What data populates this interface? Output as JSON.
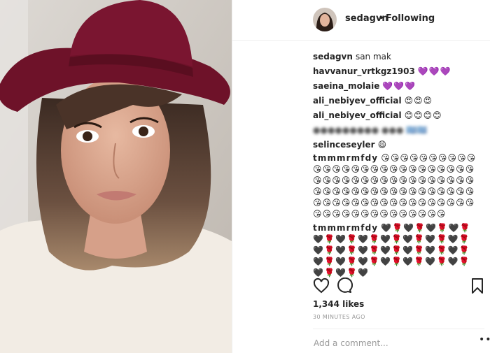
{
  "header": {
    "username": "sedagvn",
    "separator": "•",
    "follow_status": "Following"
  },
  "comments": [
    {
      "user": "sedagvn",
      "text": "san mak"
    },
    {
      "user": "havvanur_vrtkgz1903",
      "text": "💜💜💜"
    },
    {
      "user": "saeina_molaie",
      "text": "💜💜💜"
    },
    {
      "user": "ali_nebiyev_official",
      "text": "😍😍😍"
    },
    {
      "user": "ali_nebiyev_official",
      "text": "😊😊😊😊"
    },
    {
      "user": "",
      "text": "●●●●●●●●● ●●● 🇬🇷🇬🇷"
    },
    {
      "user": "selinceseyler",
      "text": "😄"
    },
    {
      "user": "tmmmrmfdy",
      "text": "😘😘😘😘😘😘😘😘😘😘😘😘😘😘😘😘😘😘😘😘😘😘😘😘😘😘😘😘😘😘😘😘😘😘😘😘😘😘😘😘😘😘😘😘😘😘😘😘😘😘😘😘😘😘😘😘😘😘😘😘😘😘😘😘😘😘😘😘😘😘😘😘😘😘😘😘😘😘😘😘😘😘😘😘😘😘😘😘😘😘😘😘"
    },
    {
      "user": "tmmmrmfdy",
      "text": "🖤🌹🖤🌹🖤🌹🖤🌹🖤🌹🖤🌹🖤🌹🖤🌹🖤🌹🖤🌹🖤🌹🖤🌹🖤🌹🖤🌹🖤🌹🖤🌹🖤🌹🖤🌹🖤🌹🖤🌹🖤🌹🖤🌹🖤🌹🖤🌹🖤🌹🖤🌹🖤🌹🖤"
    }
  ],
  "likes": "1,344 likes",
  "timestamp": "30 MINUTES AGO",
  "comment_placeholder": "Add a comment...",
  "more_label": "•••",
  "icons": {
    "like": "heart-icon",
    "comment": "comment-bubble-icon",
    "save": "bookmark-icon",
    "more": "more-options-icon"
  },
  "colors": {
    "hat": "#7a1530",
    "heart_purple": "#7b5cd6",
    "text": "#262626",
    "muted": "#999999"
  }
}
